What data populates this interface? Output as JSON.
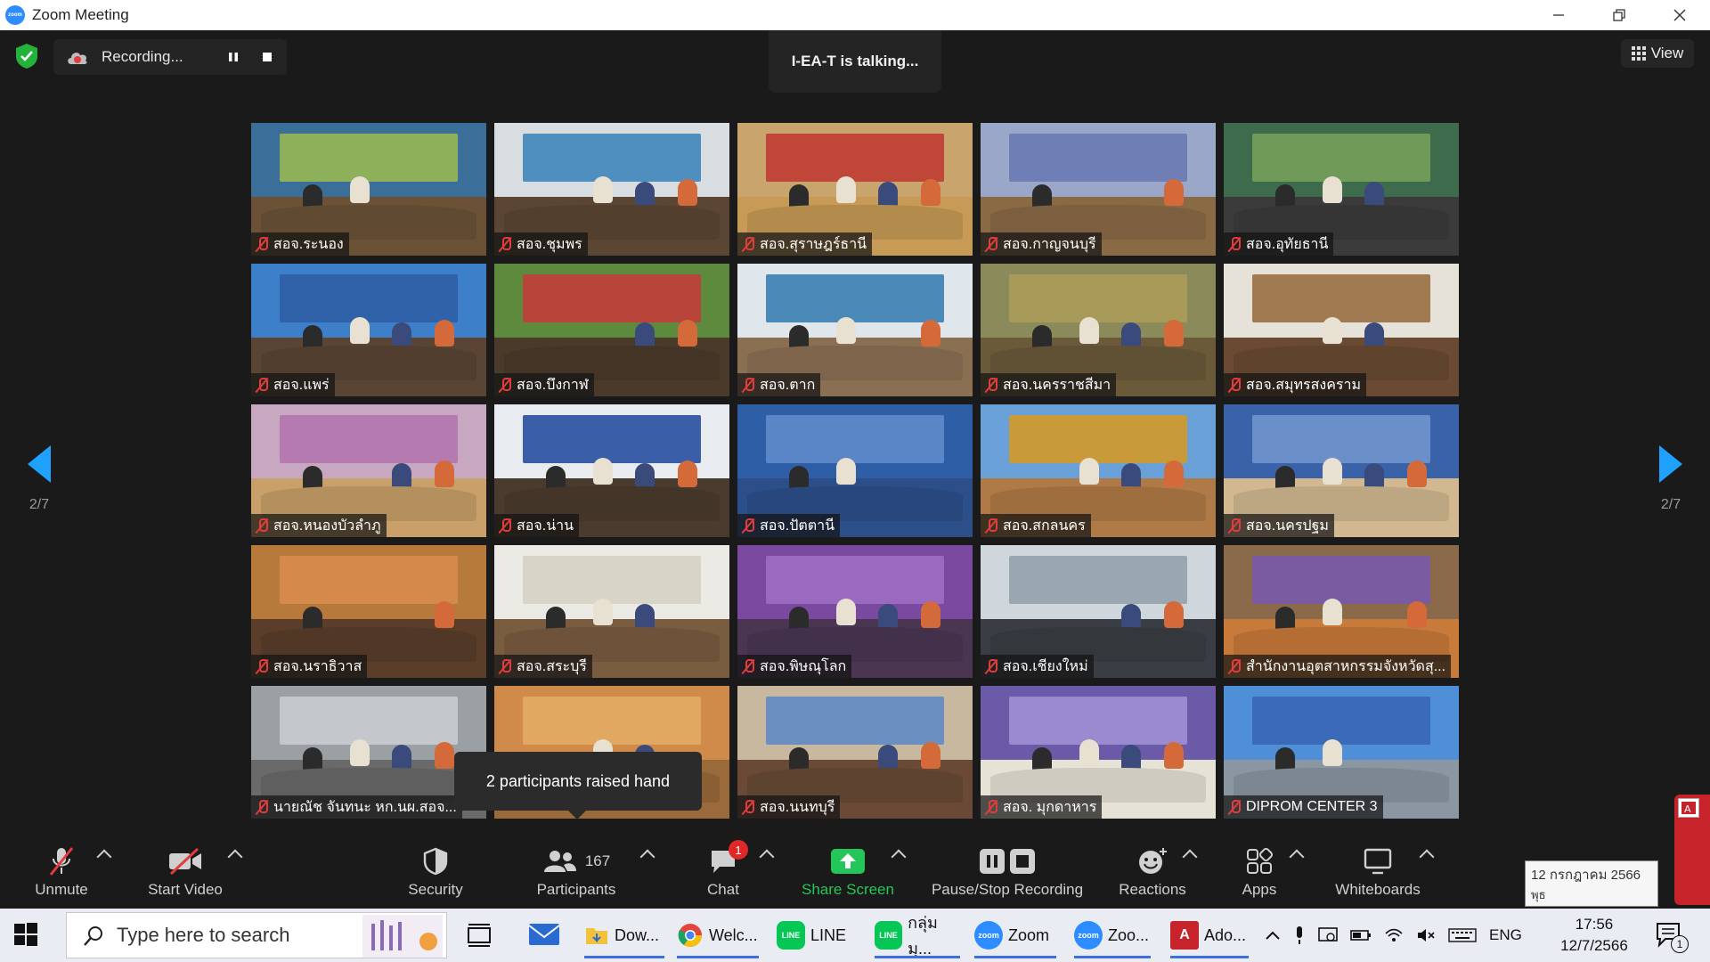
{
  "window": {
    "title": "Zoom Meeting",
    "app_icon": "zoom-logo"
  },
  "top": {
    "recording_label": "Recording...",
    "talking": "I-EA-T is talking...",
    "view_label": "View"
  },
  "pages": {
    "left": "2/7",
    "right": "2/7"
  },
  "tiles": [
    {
      "name": "สอจ.ระนอง",
      "wall": "#3c6e9a",
      "banner": "#8fb05a",
      "table": "#6b5236"
    },
    {
      "name": "สอจ.ชุมพร",
      "wall": "#d8dde2",
      "banner": "#4f8fc0",
      "table": "#5b4633"
    },
    {
      "name": "สอจ.สุราษฎร์ธานี",
      "wall": "#c9a56e",
      "banner": "#c0463a",
      "table": "#c79a55"
    },
    {
      "name": "สอจ.กาญจนบุรี",
      "wall": "#9aa7c9",
      "banner": "#6f7fb5",
      "table": "#8a6a45"
    },
    {
      "name": "สอจ.อุทัยธานี",
      "wall": "#3f6b4d",
      "banner": "#6f9a58",
      "table": "#3b3b3b"
    },
    {
      "name": "สอจ.แพร่",
      "wall": "#3d7fc8",
      "banner": "#2f62a8",
      "table": "#5a4534"
    },
    {
      "name": "สอจ.บึงกาฬ",
      "wall": "#5d8a3c",
      "banner": "#b9443a",
      "table": "#4a3a2a"
    },
    {
      "name": "สอจ.ตาก",
      "wall": "#dfe6ec",
      "banner": "#4a89b8",
      "table": "#8b6f52"
    },
    {
      "name": "สอจ.นครราชสีมา",
      "wall": "#8a8a5a",
      "banner": "#a89a58",
      "table": "#6b5a3a"
    },
    {
      "name": "สอจ.สมุทรสงคราม",
      "wall": "#e6e2da",
      "banner": "#a07a50",
      "table": "#6a4a32"
    },
    {
      "name": "สอจ.หนองบัวลำภู",
      "wall": "#c8a8c0",
      "banner": "#b57ab0",
      "table": "#c9a06a"
    },
    {
      "name": "สอจ.น่าน",
      "wall": "#e8ecf0",
      "banner": "#3a5fa8",
      "table": "#4b3b2e"
    },
    {
      "name": "สอจ.ปัตตานี",
      "wall": "#2e5fa6",
      "banner": "#5a86c8",
      "table": "#2c4f8a"
    },
    {
      "name": "สอจ.สกลนคร",
      "wall": "#6aa0d8",
      "banner": "#c89a3a",
      "table": "#b07a46"
    },
    {
      "name": "สอจ.นครปฐม",
      "wall": "#3a62a8",
      "banner": "#6b8fc9",
      "table": "#d2b890"
    },
    {
      "name": "สอจ.นราธิวาส",
      "wall": "#b87a3a",
      "banner": "#d48a4a",
      "table": "#5a3e2a"
    },
    {
      "name": "สอจ.สระบุรี",
      "wall": "#eceae4",
      "banner": "#d8d4c8",
      "table": "#7a5c40"
    },
    {
      "name": "สอจ.พิษณุโลก",
      "wall": "#7a4aa0",
      "banner": "#9a6ac0",
      "table": "#4a3552"
    },
    {
      "name": "สอจ.เชียงใหม่",
      "wall": "#cfd6dc",
      "banner": "#9aa6b0",
      "table": "#3a3e44"
    },
    {
      "name": "สำนักงานอุตสาหกรรมจังหวัดสุ...",
      "wall": "#8a6a4a",
      "banner": "#7a5aa0",
      "table": "#c87a3a"
    },
    {
      "name": "นายณัช จันทนะ หก.นผ.สอจ...",
      "wall": "#9aa0a4",
      "banner": "#c4c8cc",
      "table": "#6a6a6a"
    },
    {
      "name": "",
      "wall": "#d08a4a",
      "banner": "#e0a860",
      "table": "#9a6a3a"
    },
    {
      "name": "สอจ.นนทบุรี",
      "wall": "#c8b8a0",
      "banner": "#6a8fc0",
      "table": "#6a4a36"
    },
    {
      "name": "สอจ. มุกดาหาร",
      "wall": "#6a5aa8",
      "banner": "#9a8ad0",
      "table": "#e6e2d6"
    },
    {
      "name": "DIPROM CENTER 3",
      "wall": "#4f8fd8",
      "banner": "#3a6ab8",
      "table": "#8a96a2"
    }
  ],
  "popup": {
    "text": "2 participants raised hand"
  },
  "toolbar": {
    "unmute": "Unmute",
    "start_video": "Start Video",
    "security": "Security",
    "participants": "Participants",
    "participants_count": "167",
    "chat": "Chat",
    "chat_badge": "1",
    "share_screen": "Share Screen",
    "pause_stop_recording": "Pause/Stop Recording",
    "reactions": "Reactions",
    "apps": "Apps",
    "whiteboards": "Whiteboards"
  },
  "calendar_tip": {
    "line1": "12 กรกฎาคม 2566",
    "line2": "พุธ"
  },
  "taskbar": {
    "search_placeholder": "Type here to search",
    "apps": [
      {
        "label": "Dow...",
        "icon": "folder-icon"
      },
      {
        "label": "Welc...",
        "icon": "chrome-icon"
      },
      {
        "label": "LINE",
        "icon": "line-icon"
      },
      {
        "label": "กลุ่มมุ...",
        "icon": "line-icon"
      },
      {
        "label": "Zoom",
        "icon": "zoom-icon"
      },
      {
        "label": "Zoo...",
        "icon": "zoom-icon"
      },
      {
        "label": "Ado...",
        "icon": "adobe-icon"
      }
    ],
    "language": "ENG",
    "time": "17:56",
    "date": "12/7/2566",
    "notification_count": "1"
  },
  "colors": {
    "accent_blue": "#1ea1ff",
    "share_green": "#24c659",
    "muted_red": "#e23c3c",
    "badge_red": "#e02828"
  }
}
